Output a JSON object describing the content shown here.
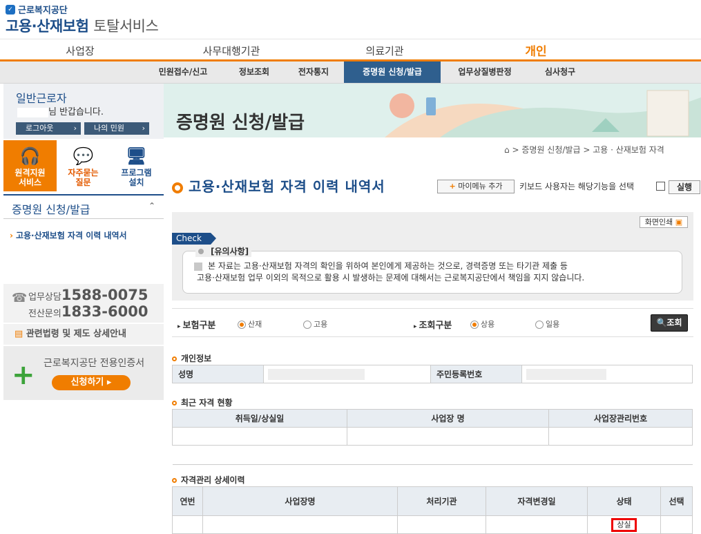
{
  "header": {
    "org": "근로복지공단",
    "title_main": "고용·산재보험",
    "title_sub": "토탈서비스"
  },
  "topnav": [
    "사업장",
    "사무대행기관",
    "의료기관",
    "개인"
  ],
  "subnav": [
    "민원접수/신고",
    "정보조회",
    "전자통지",
    "증명원 신청/발급",
    "업무상질병판정",
    "심사청구"
  ],
  "user": {
    "type": "일반근로자",
    "greeting": "님 반갑습니다.",
    "logout": "로그아웃",
    "my_civil": "나의 민원"
  },
  "quick": [
    {
      "icon": "headset-icon",
      "label1": "원격지원",
      "label2": "서비스"
    },
    {
      "icon": "chat-icon",
      "label1": "자주묻는",
      "label2": "질문"
    },
    {
      "icon": "monitor-icon",
      "label1": "프로그램",
      "label2": "설치"
    }
  ],
  "leftmenu": {
    "title": "증명원 신청/발급",
    "item": "고용·산재보험 자격 이력 내역서"
  },
  "contact": {
    "label1": "업무상담",
    "num1": "1588-0075",
    "label2": "전산문의",
    "num2": "1833-6000"
  },
  "law": "관련법령 및 제도 상세안내",
  "cert": {
    "title": "근로복지공단 전용인증서",
    "button": "신청하기"
  },
  "banner": {
    "title": "증명원 신청/발급"
  },
  "breadcrumb": [
    "증명원 신청/발급",
    "고용 · 산재보험 자격"
  ],
  "page": {
    "title": "고용·산재보험 자격 이력 내역서",
    "mymenu": "마이메뉴 추가",
    "keyboard": "키보드 사용자는 해당기능을 선택",
    "run": "실행",
    "print": "화면인쇄"
  },
  "check": {
    "tag": "Check",
    "title": "[유의사항]",
    "line1": "본 자료는 고용·산재보험 자격의 확인을 위하여 본인에게 제공하는 것으로, 경력증명 또는 타기관 제출 등",
    "line2": "고용·산재보험 업무 이외의 목적으로 활용 시 발생하는 문제에 대해서는 근로복지공단에서 책임을 지지 않습니다."
  },
  "search": {
    "insurance_label": "보험구분",
    "insurance_options": [
      "산재",
      "고용"
    ],
    "insurance_selected": 0,
    "query_label": "조회구분",
    "query_options": [
      "상용",
      "일용"
    ],
    "query_selected": 0,
    "button": "조회"
  },
  "personal": {
    "section": "개인정보",
    "name_label": "성명",
    "rrn_label": "주민등록번호"
  },
  "recent": {
    "section": "최근 자격 현황",
    "headers": [
      "취득일/상실일",
      "사업장 명",
      "사업장관리번호"
    ]
  },
  "detail": {
    "section": "자격관리 상세이력",
    "headers": [
      "연번",
      "사업장명",
      "처리기관",
      "자격변경일",
      "상태",
      "선택"
    ],
    "status": "상실"
  },
  "colors": {
    "accent": "#f07d00",
    "navy": "#1d4e89"
  }
}
